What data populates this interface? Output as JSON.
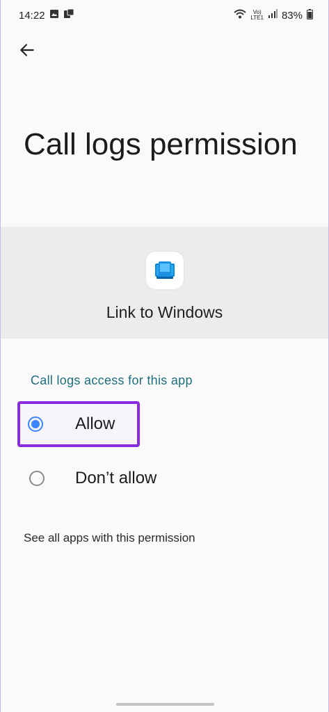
{
  "status_bar": {
    "time": "14:22",
    "left_icons": [
      "gallery-icon",
      "messages-icon"
    ],
    "right_icons": [
      "wifi-icon",
      "volte-icon",
      "signal-icon",
      "battery-icon"
    ],
    "network_label_top": "Vo)",
    "network_label_bottom": "LTE1",
    "battery": "83%"
  },
  "header": {
    "back_icon": "arrow-left-icon"
  },
  "page": {
    "title": "Call logs permission"
  },
  "app": {
    "name": "Link to Windows",
    "icon": "link-to-windows-icon",
    "icon_color": "#0a8ad8"
  },
  "permission": {
    "section_heading": "Call logs access for this app",
    "options": [
      {
        "label": "Allow",
        "selected": true
      },
      {
        "label": "Don’t allow",
        "selected": false
      }
    ],
    "see_all_link": "See all apps with this permission"
  },
  "colors": {
    "accent": "#3a86ff",
    "heading_teal": "#1d6f80",
    "highlight_box": "#8a2be2"
  }
}
